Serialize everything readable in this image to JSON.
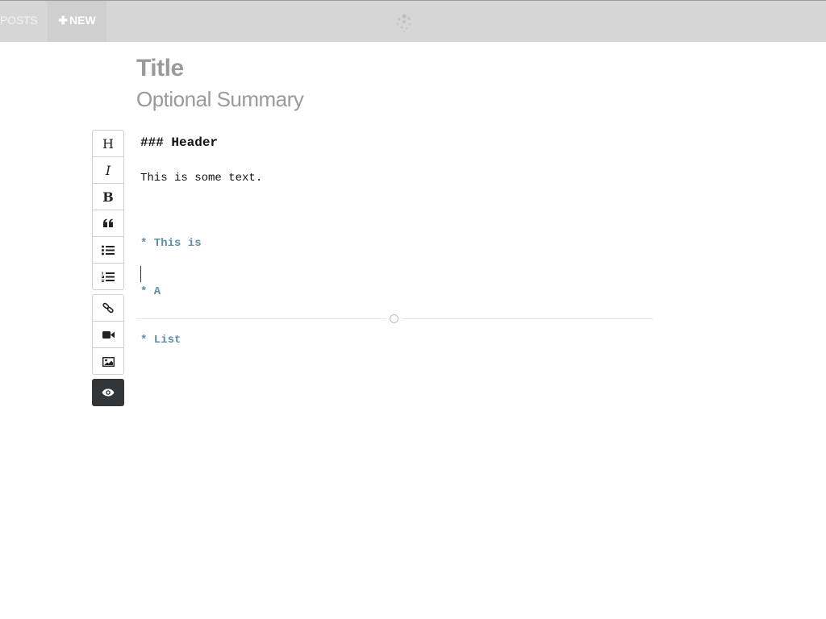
{
  "nav": {
    "posts_label": "POSTS",
    "new_label": "NEW",
    "new_icon": "plus-icon"
  },
  "logo": {
    "icon": "dots-logo-icon"
  },
  "post": {
    "title_placeholder": "Title",
    "summary_placeholder": "Optional Summary"
  },
  "toolbar": {
    "header_glyph": "H",
    "italic_glyph": "I",
    "bold_glyph": "B",
    "icons": [
      "quote-icon",
      "bulleted-list-icon",
      "numbered-list-icon",
      "link-icon",
      "video-icon",
      "image-icon",
      "preview-eye-icon"
    ]
  },
  "editor": {
    "header_line": "### Header",
    "text_line": "This is some text.",
    "list_lines": [
      "* This is",
      "* A",
      "* List"
    ]
  },
  "colors": {
    "topbar": "#d6d6d6",
    "list_markup": "#5b8fa8",
    "preview_button": "#333638"
  }
}
